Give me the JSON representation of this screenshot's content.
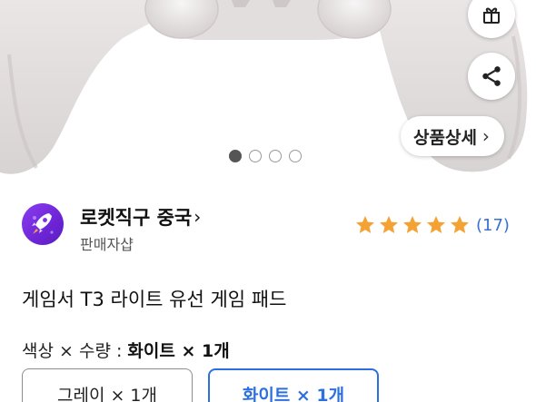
{
  "gallery": {
    "image_alt": "controller",
    "dots": [
      "active",
      "",
      "",
      ""
    ]
  },
  "actions": {
    "gift_icon": "gift-icon",
    "share_icon": "share-icon"
  },
  "detail_chip": {
    "label": "상품상세",
    "chevron": "›"
  },
  "seller": {
    "name": "로켓직구 중국",
    "chevron": "›",
    "sub": "판매자샵",
    "logo_icon": "rocket-icon"
  },
  "rating": {
    "stars": 5,
    "count": "(17)",
    "star_color": "#f4a233"
  },
  "product": {
    "title": "게임서 T3 라이트 유선 게임 패드"
  },
  "options": {
    "label": "색상 × 수량 :",
    "selected": "화이트 × 1개",
    "buttons": [
      {
        "label": "그레이 × 1개",
        "selected": false
      },
      {
        "label": "화이트 × 1개",
        "selected": true
      }
    ]
  },
  "colors": {
    "accent": "#2e6fe0",
    "link": "#3a6fd0",
    "seller_logo": "#7b2fe6"
  }
}
